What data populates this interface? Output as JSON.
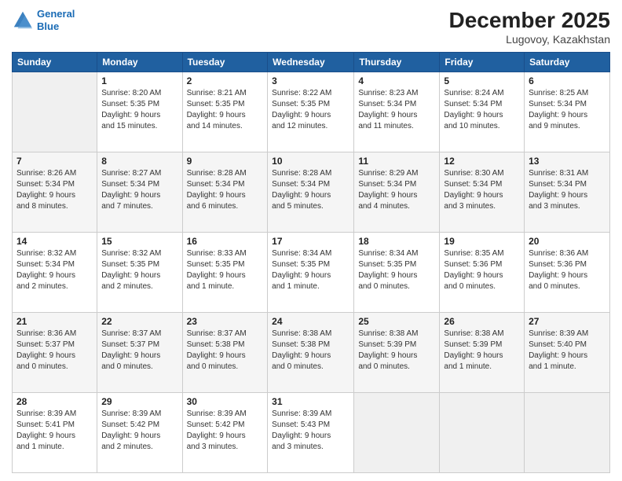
{
  "header": {
    "logo_line1": "General",
    "logo_line2": "Blue",
    "main_title": "December 2025",
    "subtitle": "Lugovoy, Kazakhstan"
  },
  "days_of_week": [
    "Sunday",
    "Monday",
    "Tuesday",
    "Wednesday",
    "Thursday",
    "Friday",
    "Saturday"
  ],
  "weeks": [
    [
      {
        "day": "",
        "info": ""
      },
      {
        "day": "1",
        "info": "Sunrise: 8:20 AM\nSunset: 5:35 PM\nDaylight: 9 hours\nand 15 minutes."
      },
      {
        "day": "2",
        "info": "Sunrise: 8:21 AM\nSunset: 5:35 PM\nDaylight: 9 hours\nand 14 minutes."
      },
      {
        "day": "3",
        "info": "Sunrise: 8:22 AM\nSunset: 5:35 PM\nDaylight: 9 hours\nand 12 minutes."
      },
      {
        "day": "4",
        "info": "Sunrise: 8:23 AM\nSunset: 5:34 PM\nDaylight: 9 hours\nand 11 minutes."
      },
      {
        "day": "5",
        "info": "Sunrise: 8:24 AM\nSunset: 5:34 PM\nDaylight: 9 hours\nand 10 minutes."
      },
      {
        "day": "6",
        "info": "Sunrise: 8:25 AM\nSunset: 5:34 PM\nDaylight: 9 hours\nand 9 minutes."
      }
    ],
    [
      {
        "day": "7",
        "info": "Sunrise: 8:26 AM\nSunset: 5:34 PM\nDaylight: 9 hours\nand 8 minutes."
      },
      {
        "day": "8",
        "info": "Sunrise: 8:27 AM\nSunset: 5:34 PM\nDaylight: 9 hours\nand 7 minutes."
      },
      {
        "day": "9",
        "info": "Sunrise: 8:28 AM\nSunset: 5:34 PM\nDaylight: 9 hours\nand 6 minutes."
      },
      {
        "day": "10",
        "info": "Sunrise: 8:28 AM\nSunset: 5:34 PM\nDaylight: 9 hours\nand 5 minutes."
      },
      {
        "day": "11",
        "info": "Sunrise: 8:29 AM\nSunset: 5:34 PM\nDaylight: 9 hours\nand 4 minutes."
      },
      {
        "day": "12",
        "info": "Sunrise: 8:30 AM\nSunset: 5:34 PM\nDaylight: 9 hours\nand 3 minutes."
      },
      {
        "day": "13",
        "info": "Sunrise: 8:31 AM\nSunset: 5:34 PM\nDaylight: 9 hours\nand 3 minutes."
      }
    ],
    [
      {
        "day": "14",
        "info": "Sunrise: 8:32 AM\nSunset: 5:34 PM\nDaylight: 9 hours\nand 2 minutes."
      },
      {
        "day": "15",
        "info": "Sunrise: 8:32 AM\nSunset: 5:35 PM\nDaylight: 9 hours\nand 2 minutes."
      },
      {
        "day": "16",
        "info": "Sunrise: 8:33 AM\nSunset: 5:35 PM\nDaylight: 9 hours\nand 1 minute."
      },
      {
        "day": "17",
        "info": "Sunrise: 8:34 AM\nSunset: 5:35 PM\nDaylight: 9 hours\nand 1 minute."
      },
      {
        "day": "18",
        "info": "Sunrise: 8:34 AM\nSunset: 5:35 PM\nDaylight: 9 hours\nand 0 minutes."
      },
      {
        "day": "19",
        "info": "Sunrise: 8:35 AM\nSunset: 5:36 PM\nDaylight: 9 hours\nand 0 minutes."
      },
      {
        "day": "20",
        "info": "Sunrise: 8:36 AM\nSunset: 5:36 PM\nDaylight: 9 hours\nand 0 minutes."
      }
    ],
    [
      {
        "day": "21",
        "info": "Sunrise: 8:36 AM\nSunset: 5:37 PM\nDaylight: 9 hours\nand 0 minutes."
      },
      {
        "day": "22",
        "info": "Sunrise: 8:37 AM\nSunset: 5:37 PM\nDaylight: 9 hours\nand 0 minutes."
      },
      {
        "day": "23",
        "info": "Sunrise: 8:37 AM\nSunset: 5:38 PM\nDaylight: 9 hours\nand 0 minutes."
      },
      {
        "day": "24",
        "info": "Sunrise: 8:38 AM\nSunset: 5:38 PM\nDaylight: 9 hours\nand 0 minutes."
      },
      {
        "day": "25",
        "info": "Sunrise: 8:38 AM\nSunset: 5:39 PM\nDaylight: 9 hours\nand 0 minutes."
      },
      {
        "day": "26",
        "info": "Sunrise: 8:38 AM\nSunset: 5:39 PM\nDaylight: 9 hours\nand 1 minute."
      },
      {
        "day": "27",
        "info": "Sunrise: 8:39 AM\nSunset: 5:40 PM\nDaylight: 9 hours\nand 1 minute."
      }
    ],
    [
      {
        "day": "28",
        "info": "Sunrise: 8:39 AM\nSunset: 5:41 PM\nDaylight: 9 hours\nand 1 minute."
      },
      {
        "day": "29",
        "info": "Sunrise: 8:39 AM\nSunset: 5:42 PM\nDaylight: 9 hours\nand 2 minutes."
      },
      {
        "day": "30",
        "info": "Sunrise: 8:39 AM\nSunset: 5:42 PM\nDaylight: 9 hours\nand 3 minutes."
      },
      {
        "day": "31",
        "info": "Sunrise: 8:39 AM\nSunset: 5:43 PM\nDaylight: 9 hours\nand 3 minutes."
      },
      {
        "day": "",
        "info": ""
      },
      {
        "day": "",
        "info": ""
      },
      {
        "day": "",
        "info": ""
      }
    ]
  ]
}
